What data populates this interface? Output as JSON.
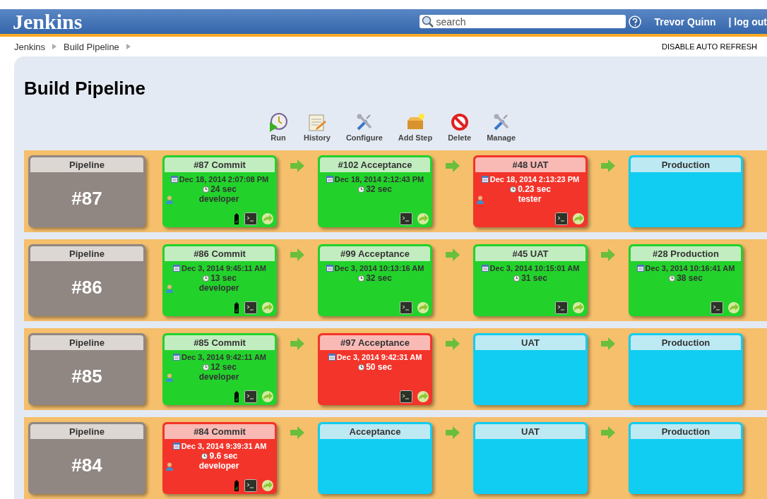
{
  "header": {
    "logo": "Jenkins",
    "search": {
      "placeholder": "search"
    },
    "user": "Trevor Quinn",
    "logout": "| log out"
  },
  "breadcrumbs": [
    "Jenkins",
    "Build Pipeline"
  ],
  "auto_refresh": "DISABLE AUTO REFRESH",
  "title": "Build Pipeline",
  "toolbar": [
    {
      "label": "Run",
      "kind": "run"
    },
    {
      "label": "History",
      "kind": "history"
    },
    {
      "label": "Configure",
      "kind": "configure"
    },
    {
      "label": "Add Step",
      "kind": "add"
    },
    {
      "label": "Delete",
      "kind": "delete"
    },
    {
      "label": "Manage",
      "kind": "manage"
    }
  ],
  "pipelines": [
    {
      "label": "Pipeline",
      "number": "#87",
      "stages": [
        {
          "kind": "success",
          "title": "#87 Commit",
          "date": "Dec 18, 2014 2:07:08 PM",
          "duration": "24 sec",
          "user": "developer",
          "tagged": true
        },
        {
          "kind": "success",
          "title": "#102 Acceptance",
          "date": "Dec 18, 2014 2:12:43 PM",
          "duration": "32 sec",
          "tagged": false
        },
        {
          "kind": "failure",
          "title": "#48 UAT",
          "date": "Dec 18, 2014 2:13:23 PM",
          "duration": "0.23 sec",
          "user": "tester",
          "tagged": false
        },
        {
          "kind": "pending",
          "title": "Production"
        }
      ]
    },
    {
      "label": "Pipeline",
      "number": "#86",
      "stages": [
        {
          "kind": "success",
          "title": "#86 Commit",
          "date": "Dec 3, 2014 9:45:11 AM",
          "duration": "13 sec",
          "user": "developer",
          "tagged": true
        },
        {
          "kind": "success",
          "title": "#99 Acceptance",
          "date": "Dec 3, 2014 10:13:16 AM",
          "duration": "32 sec",
          "tagged": false
        },
        {
          "kind": "success",
          "title": "#45 UAT",
          "date": "Dec 3, 2014 10:15:01 AM",
          "duration": "31 sec",
          "tagged": false
        },
        {
          "kind": "success",
          "title": "#28 Production",
          "date": "Dec 3, 2014 10:16:41 AM",
          "duration": "38 sec",
          "tagged": false
        }
      ]
    },
    {
      "label": "Pipeline",
      "number": "#85",
      "stages": [
        {
          "kind": "success",
          "title": "#85 Commit",
          "date": "Dec 3, 2014 9:42:11 AM",
          "duration": "12 sec",
          "user": "developer",
          "tagged": true
        },
        {
          "kind": "failure",
          "title": "#97 Acceptance",
          "date": "Dec 3, 2014 9:42:31 AM",
          "duration": "50 sec",
          "tagged": false
        },
        {
          "kind": "pending",
          "title": "UAT"
        },
        {
          "kind": "pending",
          "title": "Production"
        }
      ]
    },
    {
      "label": "Pipeline",
      "number": "#84",
      "stages": [
        {
          "kind": "failure",
          "title": "#84 Commit",
          "date": "Dec 3, 2014 9:39:31 AM",
          "duration": "9.6 sec",
          "user": "developer",
          "tagged": true
        },
        {
          "kind": "pending",
          "title": "Acceptance"
        },
        {
          "kind": "pending",
          "title": "UAT"
        },
        {
          "kind": "pending",
          "title": "Production"
        }
      ]
    }
  ]
}
